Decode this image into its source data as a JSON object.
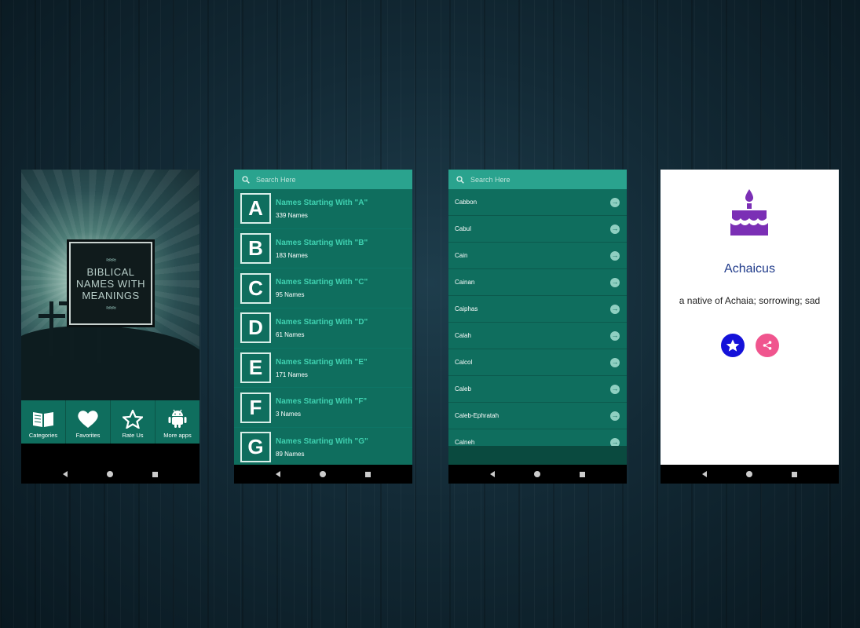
{
  "screen1": {
    "sign_lines": [
      "BIBLICAL",
      "NAMES WITH",
      "MEANINGS"
    ],
    "menu": [
      {
        "label": "Categories",
        "icon": "book-icon"
      },
      {
        "label": "Favorites",
        "icon": "heart-icon"
      },
      {
        "label": "Rate Us",
        "icon": "star-icon"
      },
      {
        "label": "More apps",
        "icon": "android-icon"
      }
    ]
  },
  "screen2": {
    "search_placeholder": "Search Here",
    "items": [
      {
        "letter": "A",
        "title": "Names Starting With \"A\"",
        "count": "339 Names"
      },
      {
        "letter": "B",
        "title": "Names Starting With \"B\"",
        "count": "183 Names"
      },
      {
        "letter": "C",
        "title": "Names Starting With \"C\"",
        "count": "95 Names"
      },
      {
        "letter": "D",
        "title": "Names Starting With \"D\"",
        "count": "61 Names"
      },
      {
        "letter": "E",
        "title": "Names Starting With \"E\"",
        "count": "171 Names"
      },
      {
        "letter": "F",
        "title": "Names Starting With \"F\"",
        "count": "3 Names"
      },
      {
        "letter": "G",
        "title": "Names Starting With \"G\"",
        "count": "89 Names"
      }
    ]
  },
  "screen3": {
    "search_placeholder": "Search Here",
    "names": [
      "Cabbon",
      "Cabul",
      "Cain",
      "Cainan",
      "Caiphas",
      "Calah",
      "Calcol",
      "Caleb",
      "Caleb-Ephratah",
      "Calneh"
    ]
  },
  "screen4": {
    "name": "Achaicus",
    "meaning": "a native of Achaia; sorrowing; sad",
    "icon": "birthday-cake-icon",
    "colors": {
      "cake": "#7b2fb5",
      "favorite": "#1411d9",
      "share": "#f0558e",
      "title": "#1f3a8a"
    }
  },
  "theme": {
    "primary": "#0f6e5e",
    "search_bar": "#2aa38e",
    "accent_text": "#3fd1b0"
  }
}
